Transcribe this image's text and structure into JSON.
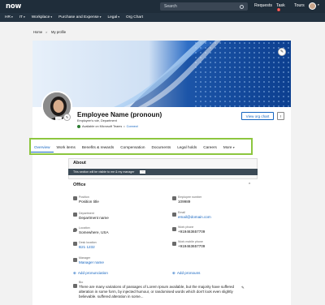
{
  "topbar": {
    "logo": "now",
    "search_placeholder": "Search",
    "requests": "Requests",
    "task": "Task",
    "task_badge": "1",
    "tours": "Tours"
  },
  "nav": {
    "items": [
      "HR",
      "IT",
      "Workplace",
      "Purchase and Expense",
      "Legal",
      "Org Chart"
    ]
  },
  "breadcrumb": {
    "home": "Home",
    "sep": ">",
    "current": "My profile"
  },
  "profile": {
    "name": "Employee Name (pronoun)",
    "role": "Employee's role, Department",
    "status": "Available on Microsoft Teams",
    "connect": "Connect",
    "view_org_chart": "View org chart",
    "more": "!"
  },
  "tabs": [
    "Overview",
    "Work items",
    "Benefits & rewards",
    "Compensation",
    "Documents",
    "Legal holds",
    "Careers",
    "More"
  ],
  "about": {
    "title": "About",
    "visibility_note": "This section will be visible to me & my manager",
    "office_title": "Office",
    "fields": {
      "position_label": "Position",
      "position_value": "Position title",
      "employee_number_label": "Employee number",
      "employee_number_value": "109989",
      "department_label": "Department",
      "department_value": "Department name",
      "email_label": "Email",
      "email_value": "email@domain.com",
      "location_label": "Location",
      "location_value": "Somewhere, USA",
      "work_phone_label": "Work phone",
      "work_phone_value": "+919463657709",
      "desk_location_label": "Desk location",
      "desk_location_value": "B21 1232",
      "work_mobile_label": "Work mobile phone",
      "work_mobile_value": "+919463657709",
      "manager_label": "Manager",
      "manager_value": "Manager name"
    },
    "add_pronunciation": "Add pronunciation",
    "add_pronouns": "Add pronouns",
    "bio_label": "Bio",
    "bio_text": "There are many variations of passages of Lorem Ipsum available, but the majority have suffered alteration in some form, by injected humour, or randomised words which don't look even slightly believable. suffered alteration in some..."
  },
  "colors": {
    "topbar": "#1f2d3a",
    "accent": "#1565c0",
    "highlight": "#8dc63f"
  }
}
